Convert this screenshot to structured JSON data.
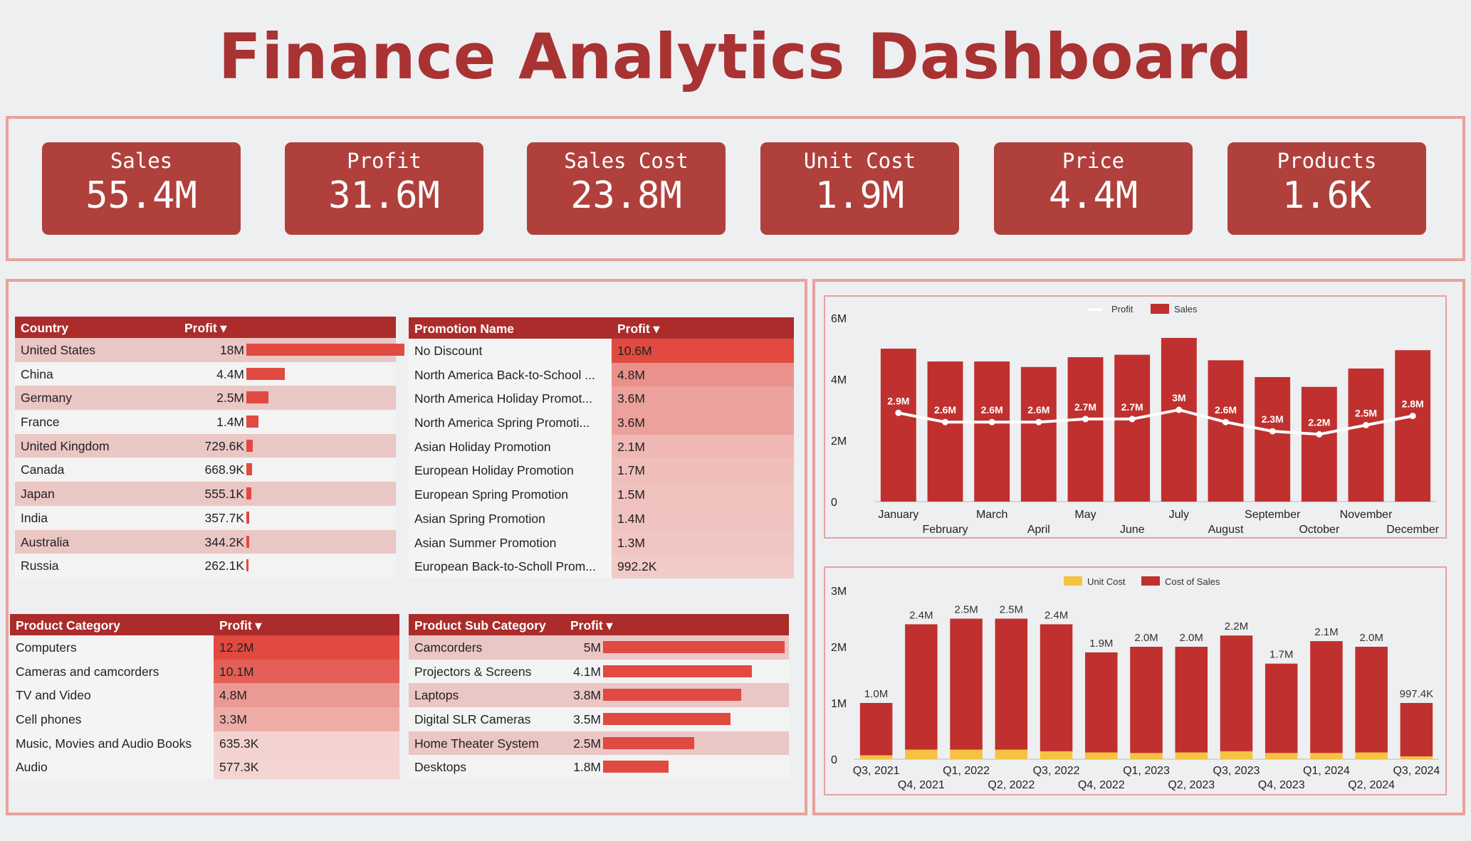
{
  "title": "Finance Analytics Dashboard",
  "kpis": [
    {
      "label": "Sales",
      "value": "55.4M"
    },
    {
      "label": "Profit",
      "value": "31.6M"
    },
    {
      "label": "Sales Cost",
      "value": "23.8M"
    },
    {
      "label": "Unit Cost",
      "value": "1.9M"
    },
    {
      "label": "Price",
      "value": "4.4M"
    },
    {
      "label": "Products",
      "value": "1.6K"
    }
  ],
  "country_table": {
    "headers": [
      "Country",
      "Profit ▾"
    ],
    "rows": [
      {
        "name": "United States",
        "value": "18M",
        "amount": 18000000
      },
      {
        "name": "China",
        "value": "4.4M",
        "amount": 4400000
      },
      {
        "name": "Germany",
        "value": "2.5M",
        "amount": 2500000
      },
      {
        "name": "France",
        "value": "1.4M",
        "amount": 1400000
      },
      {
        "name": "United Kingdom",
        "value": "729.6K",
        "amount": 729600
      },
      {
        "name": "Canada",
        "value": "668.9K",
        "amount": 668900
      },
      {
        "name": "Japan",
        "value": "555.1K",
        "amount": 555100
      },
      {
        "name": "India",
        "value": "357.7K",
        "amount": 357700
      },
      {
        "name": "Australia",
        "value": "344.2K",
        "amount": 344200
      },
      {
        "name": "Russia",
        "value": "262.1K",
        "amount": 262100
      }
    ]
  },
  "promotion_table": {
    "headers": [
      "Promotion Name",
      "Profit ▾"
    ],
    "rows": [
      {
        "name": "No Discount",
        "value": "10.6M",
        "amount": 10600000
      },
      {
        "name": "North America Back-to-School ...",
        "value": "4.8M",
        "amount": 4800000
      },
      {
        "name": "North America Holiday Promot...",
        "value": "3.6M",
        "amount": 3600000
      },
      {
        "name": "North America Spring Promoti...",
        "value": "3.6M",
        "amount": 3600000
      },
      {
        "name": "Asian Holiday Promotion",
        "value": "2.1M",
        "amount": 2100000
      },
      {
        "name": "European Holiday Promotion",
        "value": "1.7M",
        "amount": 1700000
      },
      {
        "name": "European Spring Promotion",
        "value": "1.5M",
        "amount": 1500000
      },
      {
        "name": "Asian Spring Promotion",
        "value": "1.4M",
        "amount": 1400000
      },
      {
        "name": "Asian Summer Promotion",
        "value": "1.3M",
        "amount": 1300000
      },
      {
        "name": "European Back-to-Scholl Prom...",
        "value": "992.2K",
        "amount": 992200
      }
    ]
  },
  "category_table": {
    "headers": [
      "Product Category",
      "Profit ▾"
    ],
    "rows": [
      {
        "name": "Computers",
        "value": "12.2M",
        "amount": 12200000
      },
      {
        "name": "Cameras and camcorders",
        "value": "10.1M",
        "amount": 10100000
      },
      {
        "name": "TV and Video",
        "value": "4.8M",
        "amount": 4800000
      },
      {
        "name": "Cell phones",
        "value": "3.3M",
        "amount": 3300000
      },
      {
        "name": "Music, Movies and Audio Books",
        "value": "635.3K",
        "amount": 635300
      },
      {
        "name": "Audio",
        "value": "577.3K",
        "amount": 577300
      }
    ]
  },
  "subcategory_table": {
    "headers": [
      "Product Sub Category",
      "Profit ▾"
    ],
    "rows": [
      {
        "name": "Camcorders",
        "value": "5M",
        "amount": 5000000
      },
      {
        "name": "Projectors & Screens",
        "value": "4.1M",
        "amount": 4100000
      },
      {
        "name": "Laptops",
        "value": "3.8M",
        "amount": 3800000
      },
      {
        "name": "Digital SLR Cameras",
        "value": "3.5M",
        "amount": 3500000
      },
      {
        "name": "Home Theater System",
        "value": "2.5M",
        "amount": 2500000
      },
      {
        "name": "Desktops",
        "value": "1.8M",
        "amount": 1800000
      }
    ]
  },
  "colors": {
    "header": "#ab2c2b",
    "kpi": "#b0403c",
    "bar": "#e04a41",
    "sales": "#c0302e",
    "profit_line": "#ffffff",
    "unit_cost": "#f6c243",
    "cost_of_sales": "#c0302e"
  },
  "chart_data": [
    {
      "type": "bar",
      "legend": [
        "Profit",
        "Sales"
      ],
      "legend_position": "top",
      "categories": [
        "January",
        "February",
        "March",
        "April",
        "May",
        "June",
        "July",
        "August",
        "September",
        "October",
        "November",
        "December"
      ],
      "series": [
        {
          "name": "Sales",
          "values": [
            5.0,
            4.58,
            4.58,
            4.4,
            4.72,
            4.8,
            5.35,
            4.62,
            4.07,
            3.75,
            4.35,
            4.95
          ]
        },
        {
          "name": "Profit",
          "values": [
            2.9,
            2.6,
            2.6,
            2.6,
            2.7,
            2.7,
            3.0,
            2.6,
            2.3,
            2.2,
            2.5,
            2.8
          ],
          "labels": [
            "2.9M",
            "2.6M",
            "2.6M",
            "2.6M",
            "2.7M",
            "2.7M",
            "3M",
            "2.6M",
            "2.3M",
            "2.2M",
            "2.5M",
            "2.8M"
          ]
        }
      ],
      "yticks": [
        "6M",
        "4M",
        "2M",
        "0"
      ],
      "ylim": [
        0,
        6
      ],
      "unit": "M"
    },
    {
      "type": "bar",
      "stacked": true,
      "legend": [
        "Unit Cost",
        "Cost of Sales"
      ],
      "legend_position": "top",
      "categories": [
        "Q3, 2021",
        "Q4, 2021",
        "Q1, 2022",
        "Q2, 2022",
        "Q3, 2022",
        "Q4, 2022",
        "Q1, 2023",
        "Q2, 2023",
        "Q3, 2023",
        "Q4, 2023",
        "Q1, 2024",
        "Q2, 2024",
        "Q3, 2024"
      ],
      "series": [
        {
          "name": "Unit Cost",
          "values": [
            0.07,
            0.17,
            0.17,
            0.17,
            0.14,
            0.12,
            0.11,
            0.12,
            0.14,
            0.11,
            0.11,
            0.12,
            0.05
          ]
        },
        {
          "name": "Cost of Sales",
          "values": [
            0.93,
            2.23,
            2.33,
            2.33,
            2.26,
            1.78,
            1.89,
            1.88,
            2.06,
            1.59,
            1.99,
            1.88,
            0.95
          ]
        }
      ],
      "totals": [
        "1.0M",
        "2.4M",
        "2.5M",
        "2.5M",
        "2.4M",
        "1.9M",
        "2.0M",
        "2.0M",
        "2.2M",
        "1.7M",
        "2.1M",
        "2.0M",
        "997.4K"
      ],
      "total_values": [
        1.0,
        2.4,
        2.5,
        2.5,
        2.4,
        1.9,
        2.0,
        2.0,
        2.2,
        1.7,
        2.1,
        2.0,
        0.997
      ],
      "yticks": [
        "3M",
        "2M",
        "1M",
        "0"
      ],
      "ylim": [
        0,
        3
      ],
      "unit": "M"
    }
  ]
}
